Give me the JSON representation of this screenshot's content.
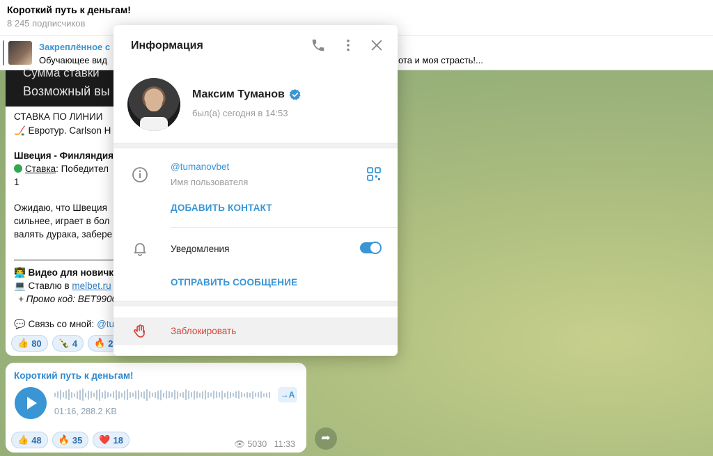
{
  "header": {
    "title": "Короткий путь к деньгам!",
    "subtitle": "8 245 подписчиков"
  },
  "pinned": {
    "title": "Закреплённое с",
    "text_left": "Обучающее вид",
    "text_right": "ота и моя страсть!..."
  },
  "message1": {
    "banner_line1": "Сумма ставки",
    "banner_line2": "Возможный вы",
    "line_bet_type": "СТАВКА ПО ЛИНИИ",
    "line_event": "🏒 Евротур. Carlson H",
    "line_match": "Швеция - Финляндия",
    "line_stake_word": "Ставка",
    "line_stake_rest": ": Победител",
    "line_one": "1",
    "line_p1": "Ожидаю, что Швеция",
    "line_p2": "сильнее, играет в бол",
    "line_p3": "валять дурака, забере",
    "line_dash": "————————————",
    "line_video": "👨‍💻 Видео для новичк",
    "line_bet_prefix": "💻 Ставлю в ",
    "line_bet_link": "melbet.ru",
    "line_promo": "+ Промо код: BET9900",
    "line_contact_prefix": "💬 Связь со мной: ",
    "line_contact_link": "@tu",
    "reactions": [
      {
        "emoji": "👍",
        "count": "80"
      },
      {
        "emoji": "🍾",
        "count": "4"
      },
      {
        "emoji": "🔥",
        "count": "2"
      }
    ]
  },
  "message2": {
    "title": "Короткий путь к деньгам!",
    "voice_meta": "01:16, 288.2 KB",
    "transcribe": "→A",
    "reactions": [
      {
        "emoji": "👍",
        "count": "48"
      },
      {
        "emoji": "🔥",
        "count": "35"
      },
      {
        "emoji": "❤️",
        "count": "18"
      }
    ],
    "views": "5030",
    "time": "11:33"
  },
  "modal": {
    "title": "Информация",
    "name": "Максим Туманов",
    "last_seen": "был(а) сегодня в 14:53",
    "username": "@tumanovbet",
    "username_label": "Имя пользователя",
    "add_contact": "ДОБАВИТЬ КОНТАКТ",
    "notifications_label": "Уведомления",
    "notifications_on": true,
    "send_message": "ОТПРАВИТЬ СООБЩЕНИЕ",
    "block": "Заблокировать",
    "icons": [
      "phone-icon",
      "more-vertical-icon",
      "close-icon",
      "verified-icon",
      "info-icon",
      "qr-code-icon",
      "bell-icon",
      "hand-icon"
    ]
  },
  "colors": {
    "accent": "#3a95d5",
    "danger": "#d1473d",
    "chat_bg": "#a3b67a"
  }
}
